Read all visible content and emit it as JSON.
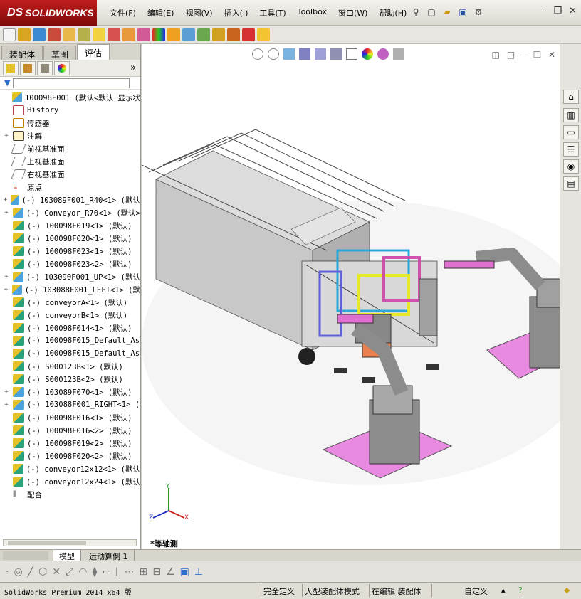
{
  "app": {
    "brand": "SOLIDWORKS",
    "brand_prefix": "DS"
  },
  "menu": [
    "文件(F)",
    "编辑(E)",
    "视图(V)",
    "插入(I)",
    "工具(T)",
    "Toolbox",
    "窗口(W)",
    "帮助(H)"
  ],
  "left_panel": {
    "tabs": [
      "装配体",
      "草图",
      "评估"
    ],
    "active_tab": "评估",
    "tree": [
      {
        "label": "100098F001  (默认<默认_显示状",
        "icon": "assembly-icon",
        "expander": "",
        "top": true
      },
      {
        "label": "History",
        "icon": "history-icon",
        "expander": ""
      },
      {
        "label": "传感器",
        "icon": "sensor-icon",
        "expander": ""
      },
      {
        "label": "注解",
        "icon": "annotation-icon",
        "expander": "+"
      },
      {
        "label": "前视基准面",
        "icon": "plane-icon",
        "expander": ""
      },
      {
        "label": "上视基准面",
        "icon": "plane-icon",
        "expander": ""
      },
      {
        "label": "右视基准面",
        "icon": "plane-icon",
        "expander": ""
      },
      {
        "label": "原点",
        "icon": "origin-icon",
        "expander": ""
      },
      {
        "label": "(-) 103089F001_R40<1> (默认",
        "icon": "subassembly-icon",
        "expander": "+"
      },
      {
        "label": "(-) Conveyor_R70<1> (默认>",
        "icon": "subassembly-icon",
        "expander": "+"
      },
      {
        "label": "(-) 100098F019<1> (默认)",
        "icon": "part-icon",
        "expander": ""
      },
      {
        "label": "(-) 100098F020<1> (默认)",
        "icon": "part-icon",
        "expander": ""
      },
      {
        "label": "(-) 100098F023<1> (默认)",
        "icon": "part-icon",
        "expander": ""
      },
      {
        "label": "(-) 100098F023<2> (默认)",
        "icon": "part-icon",
        "expander": ""
      },
      {
        "label": "(-) 103090F001_UP<1> (默认",
        "icon": "subassembly-icon",
        "expander": "+"
      },
      {
        "label": "(-) 103088F001_LEFT<1> (默",
        "icon": "subassembly-icon",
        "expander": "+"
      },
      {
        "label": "(-) conveyorA<1> (默认)",
        "icon": "part-icon",
        "expander": ""
      },
      {
        "label": "(-) conveyorB<1> (默认)",
        "icon": "part-icon",
        "expander": ""
      },
      {
        "label": "(-) 100098F014<1> (默认)",
        "icon": "part-icon",
        "expander": ""
      },
      {
        "label": "(-) 100098F015_Default_As",
        "icon": "part-icon",
        "expander": ""
      },
      {
        "label": "(-) 100098F015_Default_As",
        "icon": "part-icon",
        "expander": ""
      },
      {
        "label": "(-) S000123B<1> (默认)",
        "icon": "part-icon",
        "expander": ""
      },
      {
        "label": "(-) S000123B<2> (默认)",
        "icon": "part-icon",
        "expander": ""
      },
      {
        "label": "(-) 103089F070<1> (默认)",
        "icon": "subassembly-icon",
        "expander": "+"
      },
      {
        "label": "(-) 103088F001_RIGHT<1> (",
        "icon": "subassembly-icon",
        "expander": "+"
      },
      {
        "label": "(-) 100098F016<1> (默认)",
        "icon": "part-icon",
        "expander": ""
      },
      {
        "label": "(-) 100098F016<2> (默认)",
        "icon": "part-icon",
        "expander": ""
      },
      {
        "label": "(-) 100098F019<2> (默认)",
        "icon": "part-icon",
        "expander": ""
      },
      {
        "label": "(-) 100098F020<2> (默认)",
        "icon": "part-icon",
        "expander": ""
      },
      {
        "label": "(-) conveyor12x12<1> (默认",
        "icon": "part-icon",
        "expander": ""
      },
      {
        "label": "(-) conveyor12x24<1> (默认",
        "icon": "part-icon",
        "expander": ""
      },
      {
        "label": "配合",
        "icon": "mates-icon",
        "expander": ""
      }
    ]
  },
  "viewport": {
    "view_label": "*等轴测",
    "triad": {
      "x": "X",
      "y": "Y",
      "z": "Z"
    }
  },
  "bottom_tabs": [
    "模型",
    "运动算例 1"
  ],
  "active_bottom_tab": "模型",
  "status": {
    "product": "SolidWorks Premium 2014 x64 版",
    "fully_defined": "完全定义",
    "large_assembly": "大型装配体模式",
    "editing": "在编辑 装配体",
    "units": "自定义"
  }
}
